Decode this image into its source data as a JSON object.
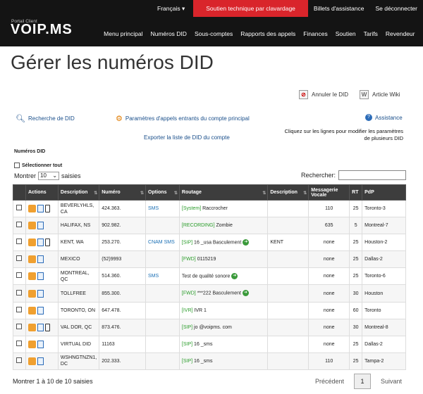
{
  "header": {
    "language": "Français",
    "support_chat": "Soutien technique par clavardage",
    "tickets": "Billets d'assistance",
    "logout": "Se déconnecter",
    "portal_label": "Portail Client",
    "logo_text": "VOIP.MS",
    "nav": [
      "Menu principal",
      "Numéros DID",
      "Sous-comptes",
      "Rapports des appels",
      "Finances",
      "Soutien",
      "Tarifs",
      "Revendeur"
    ]
  },
  "page": {
    "title": "Gérer les numéros DID",
    "cancel_did": "Annuler le DID",
    "wiki": "Article Wiki",
    "search_did": "Recherche de DID",
    "incoming_params": "Paramètres d'appels entrants du compte principal",
    "assistance": "Assistance",
    "export": "Exporter la liste de DID du compte",
    "note": "Cliquez sur les lignes pour modifier les paramètres de plusieurs DID",
    "section": "Numéros DID",
    "select_all": "Sélectionner tout",
    "show_pre": "Montrer",
    "show_val": "10",
    "show_post": "saisies",
    "search_label": "Rechercher:",
    "footer": "Montrer 1 à 10 de 10 saisies",
    "prev": "Précédent",
    "page": "1",
    "next": "Suivant"
  },
  "table": {
    "headers": [
      "Actions",
      "Description",
      "Numéro",
      "Options",
      "Routage",
      "Description",
      "Messagerie Vocale",
      "RT",
      "PdP"
    ],
    "rows": [
      {
        "desc": "BEVERLYHLS, CA",
        "num": "424.363.",
        "opt": "SMS",
        "route_tag": "[System]",
        "route": "Raccrocher",
        "desc2": "",
        "vm": "110",
        "rt": "25",
        "pop": "Toronto-3",
        "phone": true
      },
      {
        "desc": "HALIFAX, NS",
        "num": "902.982.",
        "opt": "",
        "route_tag": "[RECORDING]",
        "route": "Zombie",
        "desc2": "",
        "vm": "635",
        "rt": "5",
        "pop": "Montreal-7",
        "phone": false
      },
      {
        "desc": "KENT, WA",
        "num": "253.270.",
        "opt": "CNAM SMS",
        "route_tag": "[SIP]",
        "route": "16 _usa Basculement",
        "desc2": "KENT",
        "vm": "none",
        "rt": "25",
        "pop": "Houston-2",
        "phone": true
      },
      {
        "desc": "MEXICO",
        "num": "(52)9993",
        "opt": "",
        "route_tag": "[FWD]",
        "route": "0115219",
        "desc2": "",
        "vm": "none",
        "rt": "25",
        "pop": "Dallas-2",
        "phone": false
      },
      {
        "desc": "MONTREAL, QC",
        "num": "514.360.",
        "opt": "SMS",
        "route_tag": "",
        "route": "Test de qualité sonore",
        "desc2": "",
        "vm": "none",
        "rt": "25",
        "pop": "Toronto-6",
        "phone": false
      },
      {
        "desc": "TOLLFREE",
        "num": "855.300.",
        "opt": "",
        "route_tag": "[FWD]",
        "route": "***222 Basculement",
        "desc2": "",
        "vm": "none",
        "rt": "30",
        "pop": "Houston",
        "phone": false
      },
      {
        "desc": "TORONTO, ON",
        "num": "647.478.",
        "opt": "",
        "route_tag": "[IVR]",
        "route": "IVR 1",
        "desc2": "",
        "vm": "none",
        "rt": "60",
        "pop": "Toronto",
        "phone": false
      },
      {
        "desc": "VAL DOR, QC",
        "num": "873.476.",
        "opt": "",
        "route_tag": "[SIP]",
        "route": "jo @voipms. com",
        "desc2": "",
        "vm": "none",
        "rt": "30",
        "pop": "Montreal-8",
        "phone": true
      },
      {
        "desc": "VIRTUAL DID",
        "num": "11163",
        "opt": "",
        "route_tag": "[SIP]",
        "route": "16 _sms",
        "desc2": "",
        "vm": "none",
        "rt": "25",
        "pop": "Dallas-2",
        "phone": false
      },
      {
        "desc": "WSHNGTNZN1, DC",
        "num": "202.333.",
        "opt": "",
        "route_tag": "[SIP]",
        "route": "16 _sms",
        "desc2": "",
        "vm": "110",
        "rt": "25",
        "pop": "Tampa-2",
        "phone": false
      }
    ]
  }
}
